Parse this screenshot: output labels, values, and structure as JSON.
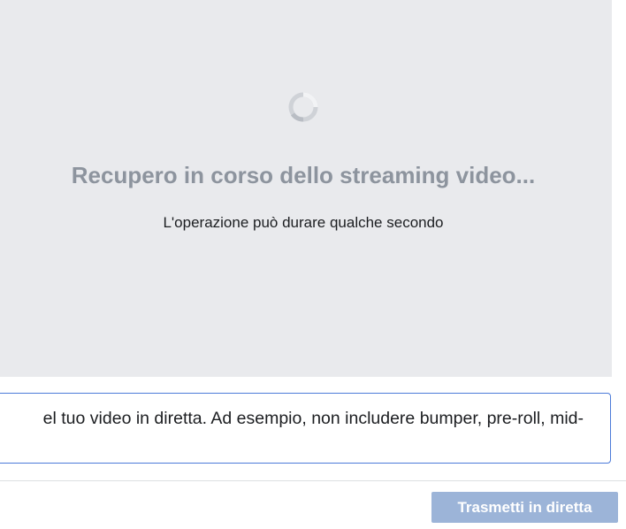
{
  "stream_preview": {
    "loading_title": "Recupero in corso dello streaming video...",
    "loading_subtitle": "L'operazione può durare qualche secondo",
    "spinner_icon": "loading-spinner-icon",
    "background_color": "#e9eaed"
  },
  "notice": {
    "text": "el tuo video in diretta. Ad esempio, non includere bumper, pre-roll, mid-",
    "border_color": "#4c7bd9"
  },
  "footer": {
    "go_live_label": "Trasmetti in diretta",
    "go_live_enabled": false,
    "button_color": "#9cb4d8"
  }
}
